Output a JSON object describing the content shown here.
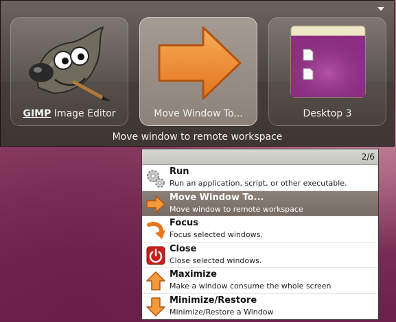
{
  "launcher": {
    "menu_icon": "chevron-down-icon",
    "tiles": [
      {
        "bold": "GIMP",
        "label": " Image Editor",
        "icon": "gimp-wilber-icon"
      },
      {
        "label": "Move Window To...",
        "icon": "arrow-right-icon"
      },
      {
        "label": "Desktop 3",
        "icon": "desktop-workspace-icon"
      }
    ],
    "status": "Move window to remote workspace"
  },
  "actions": {
    "counter": "2/6",
    "items": [
      {
        "title": "Run",
        "desc": "Run an application, script, or other executable.",
        "icon": "gears-icon"
      },
      {
        "title": "Move Window To...",
        "desc": "Move window to remote workspace",
        "icon": "arrow-right-icon",
        "selected": true
      },
      {
        "title": "Focus",
        "desc": "Focus selected windows.",
        "icon": "curved-arrow-icon"
      },
      {
        "title": "Close",
        "desc": "Close selected windows.",
        "icon": "power-icon"
      },
      {
        "title": "Maximize",
        "desc": "Make a window consume the whole screen",
        "icon": "arrow-up-icon"
      },
      {
        "title": "Minimize/Restore",
        "desc": "Minimize/Restore a Window",
        "icon": "arrow-down-icon"
      }
    ]
  },
  "colors": {
    "accent_orange": "#f08a24",
    "selected_row": "#7f746c",
    "close_red": "#c8201c"
  }
}
